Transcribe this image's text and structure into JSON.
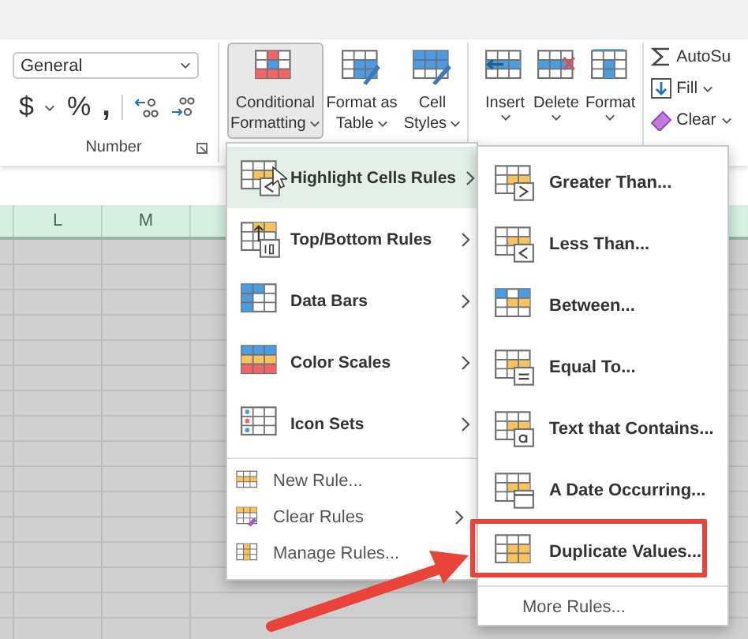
{
  "ribbon": {
    "number_group": {
      "format": "General",
      "symbols": [
        "$",
        "%",
        ","
      ],
      "label": "Number"
    },
    "buttons": [
      {
        "kind": "conditional",
        "lines": [
          "Conditional",
          "Formatting"
        ],
        "selected": true
      },
      {
        "kind": "table",
        "lines": [
          "Format as",
          "Table"
        ],
        "selected": false
      },
      {
        "kind": "styles",
        "lines": [
          "Cell",
          "Styles"
        ],
        "selected": false
      },
      {
        "kind": "insert",
        "lines": [
          "Insert"
        ],
        "selected": false
      },
      {
        "kind": "delete",
        "lines": [
          "Delete"
        ],
        "selected": false
      },
      {
        "kind": "format",
        "lines": [
          "Format"
        ],
        "selected": false
      }
    ],
    "editing": [
      {
        "kind": "sum",
        "label": "AutoSu"
      },
      {
        "kind": "fill",
        "label": "Fill"
      },
      {
        "kind": "clear",
        "label": "Clear"
      }
    ]
  },
  "columns": [
    "L",
    "M"
  ],
  "menu": {
    "items": [
      {
        "kind": "highlight",
        "label": "Highlight Cells Rules",
        "submenu": true,
        "selected": true
      },
      {
        "kind": "topbottom",
        "label": "Top/Bottom Rules",
        "submenu": true,
        "selected": false
      },
      {
        "kind": "databars",
        "label": "Data Bars",
        "submenu": true,
        "selected": false
      },
      {
        "kind": "colorscales",
        "label": "Color Scales",
        "submenu": true,
        "selected": false
      },
      {
        "kind": "iconsets",
        "label": "Icon Sets",
        "submenu": true,
        "selected": false
      }
    ],
    "commands": [
      {
        "kind": "new",
        "label": "New Rule...",
        "submenu": false
      },
      {
        "kind": "clear",
        "label": "Clear Rules",
        "submenu": true
      },
      {
        "kind": "manage",
        "label": "Manage Rules...",
        "submenu": false
      }
    ]
  },
  "submenu": {
    "items": [
      {
        "kind": "greater",
        "label": "Greater Than...",
        "callout": false
      },
      {
        "kind": "less",
        "label": "Less Than...",
        "callout": false
      },
      {
        "kind": "between",
        "label": "Between...",
        "callout": false
      },
      {
        "kind": "equal",
        "label": "Equal To...",
        "callout": false
      },
      {
        "kind": "text",
        "label": "Text that Contains...",
        "callout": false
      },
      {
        "kind": "date",
        "label": "A Date Occurring...",
        "callout": false
      },
      {
        "kind": "duplicate",
        "label": "Duplicate Values...",
        "callout": true
      }
    ],
    "footer": "More Rules..."
  }
}
